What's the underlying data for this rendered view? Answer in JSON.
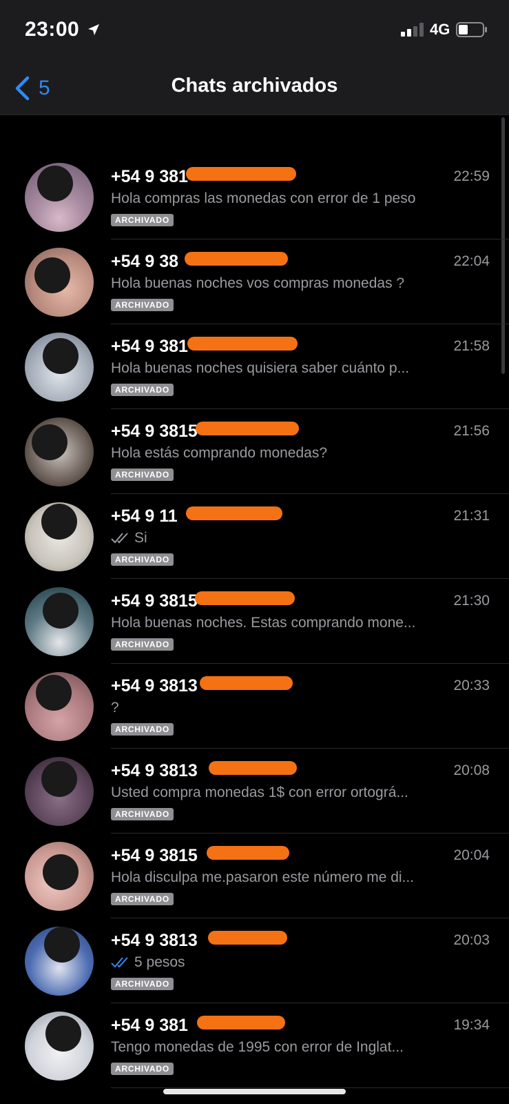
{
  "status_bar": {
    "time": "23:00",
    "network": "4G",
    "icons": [
      "location-arrow-icon",
      "signal-icon",
      "battery-icon"
    ]
  },
  "nav": {
    "back_count": "5",
    "title": "Chats archivados",
    "accent_color": "#2f8bf4"
  },
  "badge_label": "ARCHIVADO",
  "colors": {
    "redaction": "#f47214",
    "read_tick": "#2f8bf4",
    "muted_text": "#9a9aa0"
  },
  "chats": [
    {
      "name": "+54 9 381",
      "time": "22:59",
      "preview": "Hola compras las monedas con error de 1 peso",
      "tick": "none"
    },
    {
      "name": "+54 9 38",
      "time": "22:04",
      "preview": "Hola buenas noches vos compras monedas ?",
      "tick": "none"
    },
    {
      "name": "+54 9 381",
      "time": "21:58",
      "preview": "Hola buenas noches quisiera saber cuánto p...",
      "tick": "none"
    },
    {
      "name": "+54 9 3815",
      "time": "21:56",
      "preview": "Hola estás comprando monedas?",
      "tick": "none"
    },
    {
      "name": "+54 9 11",
      "time": "21:31",
      "preview": "Si",
      "tick": "delivered"
    },
    {
      "name": "+54 9 3815",
      "time": "21:30",
      "preview": "Hola buenas noches. Estas comprando mone...",
      "tick": "none"
    },
    {
      "name": "+54 9 3813",
      "time": "20:33",
      "preview": "?",
      "tick": "none"
    },
    {
      "name": "+54 9 3813",
      "time": "20:08",
      "preview": "Usted compra monedas 1$ con error ortográ...",
      "tick": "none"
    },
    {
      "name": "+54 9 3815",
      "time": "20:04",
      "preview": "Hola disculpa me.pasaron este número me di...",
      "tick": "none"
    },
    {
      "name": "+54 9 3813",
      "time": "20:03",
      "preview": "5 pesos",
      "tick": "read"
    },
    {
      "name": "+54 9 381",
      "time": "19:34",
      "preview": "Tengo monedas de 1995  con error de Inglat...",
      "tick": "none"
    }
  ]
}
